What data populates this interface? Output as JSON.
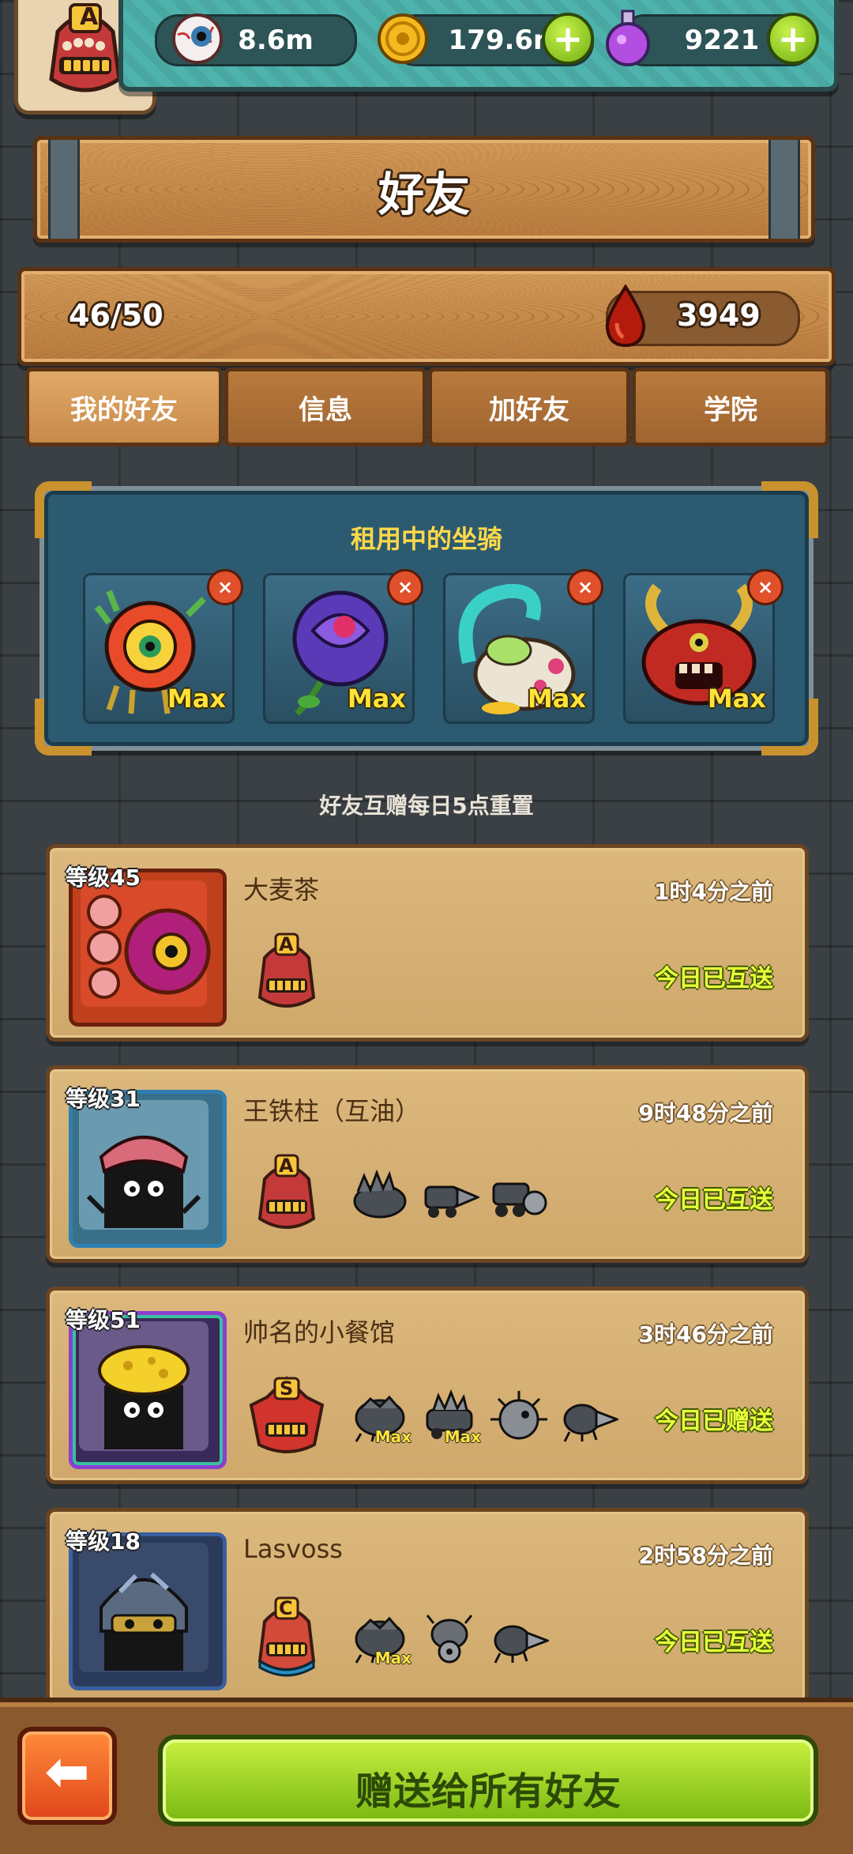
{
  "resources": {
    "eyes": "8.6m",
    "coins": "179.6m",
    "potions": "9221",
    "plus_symbol": "+"
  },
  "player_rank_letter": "A",
  "page_title": "好友",
  "friend_count": "46/50",
  "blood_drops": "3949",
  "tabs": [
    {
      "label": "我的好友",
      "active": true
    },
    {
      "label": "信息",
      "active": false
    },
    {
      "label": "加好友",
      "active": false
    },
    {
      "label": "学院",
      "active": false
    }
  ],
  "rented_mounts": {
    "title": "租用中的坐骑",
    "close_symbol": "×",
    "items": [
      {
        "icon": "lion-dance-mount-icon",
        "label": "Max",
        "color": "#c9302c"
      },
      {
        "icon": "purple-rose-mount-icon",
        "label": "Max",
        "color": "#6a3fb5"
      },
      {
        "icon": "rabbit-teal-tail-mount-icon",
        "label": "Max",
        "color": "#e8e2d0"
      },
      {
        "icon": "red-horned-demon-mount-icon",
        "label": "Max",
        "color": "#b52a22"
      }
    ]
  },
  "reset_notice": "好友互赠每日5点重置",
  "friends": [
    {
      "level": "等级45",
      "name": "大麦茶",
      "time": "1时4分之前",
      "status": "今日已互送",
      "rank": "A",
      "rank_color": "#c43a3a",
      "frame_color": "#a83a1c",
      "minis": []
    },
    {
      "level": "等级31",
      "name": "王铁柱（互油）",
      "time": "9时48分之前",
      "status": "今日已互送",
      "rank": "A",
      "rank_color": "#c43a3a",
      "frame_color": "#2f7fb0",
      "minis": [
        {
          "icon": "spiky-boar-vehicle-icon",
          "max": ""
        },
        {
          "icon": "drill-vehicle-icon",
          "max": ""
        },
        {
          "icon": "saw-cart-vehicle-icon",
          "max": ""
        }
      ]
    },
    {
      "level": "等级51",
      "name": "帅名的小餐馆",
      "time": "3时46分之前",
      "status": "今日已赠送",
      "rank": "S",
      "rank_color": "#d0342c",
      "frame_color": "#8a3fd0",
      "minis": [
        {
          "icon": "armored-bug-vehicle-icon",
          "max": "Max"
        },
        {
          "icon": "spiked-tank-vehicle-icon",
          "max": "Max"
        },
        {
          "icon": "puffer-vehicle-icon",
          "max": ""
        },
        {
          "icon": "drill-bug-vehicle-icon",
          "max": ""
        }
      ]
    },
    {
      "level": "等级18",
      "name": "Lasvoss",
      "time": "2时58分之前",
      "status": "今日已互送",
      "rank": "C",
      "rank_color": "#2a8fc4",
      "frame_color": "#3a5fa0",
      "minis": [
        {
          "icon": "armored-bug-vehicle-icon",
          "max": "Max"
        },
        {
          "icon": "wheel-crab-vehicle-icon",
          "max": ""
        },
        {
          "icon": "drill-bug-vehicle-icon",
          "max": ""
        }
      ]
    }
  ],
  "bottom": {
    "back_arrow": "⬅",
    "gift_all_label": "赠送给所有好友"
  }
}
